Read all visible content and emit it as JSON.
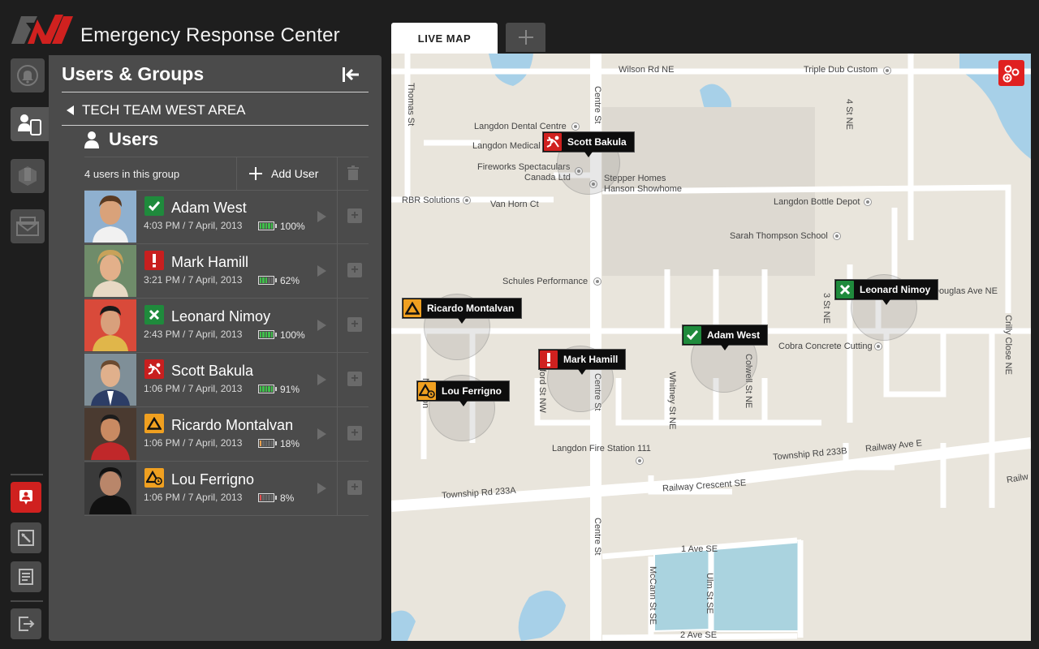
{
  "app": {
    "title": "Emergency Response Center",
    "accent": "#d0211f"
  },
  "rail": {
    "items": [
      {
        "icon": "bell-icon"
      },
      {
        "icon": "users-devices-icon",
        "active": true
      },
      {
        "icon": "buildings-icon"
      },
      {
        "icon": "mail-icon"
      },
      {
        "icon": "panic-alert-icon"
      },
      {
        "icon": "image-edit-icon"
      },
      {
        "icon": "notes-icon"
      },
      {
        "icon": "logout-icon"
      }
    ]
  },
  "panel": {
    "title": "Users & Groups",
    "breadcrumb": "TECH TEAM WEST AREA",
    "section_title": "Users",
    "count_text": "4 users in this group",
    "add_user_label": "Add User"
  },
  "users": [
    {
      "name": "Adam West",
      "time": "4:03 PM / 7 April, 2013",
      "battery": "100%",
      "battery_level": 1.0,
      "battery_color": "#3fbf4a",
      "status": "ok",
      "status_color": "#1f8a3c"
    },
    {
      "name": "Mark Hamill",
      "time": "3:21 PM / 7 April, 2013",
      "battery": "62%",
      "battery_level": 0.62,
      "battery_color": "#3fbf4a",
      "status": "alert",
      "status_color": "#c81f1f"
    },
    {
      "name": "Leonard Nimoy",
      "time": "2:43 PM / 7 April, 2013",
      "battery": "100%",
      "battery_level": 1.0,
      "battery_color": "#3fbf4a",
      "status": "cancelled",
      "status_color": "#1f8a3c"
    },
    {
      "name": "Scott Bakula",
      "time": "1:06 PM / 7 April, 2013",
      "battery": "91%",
      "battery_level": 0.91,
      "battery_color": "#3fbf4a",
      "status": "fallen",
      "status_color": "#c81f1f"
    },
    {
      "name": "Ricardo Montalvan",
      "time": "1:06 PM / 7 April, 2013",
      "battery": "18%",
      "battery_level": 0.18,
      "battery_color": "#e8a050",
      "status": "warning",
      "status_color": "#f0a020"
    },
    {
      "name": "Lou Ferrigno",
      "time": "1:06 PM / 7 April, 2013",
      "battery": "8%",
      "battery_level": 0.08,
      "battery_color": "#e05050",
      "status": "warning-timer",
      "status_color": "#f0a020"
    }
  ],
  "tabs": {
    "live_map": "LIVE MAP"
  },
  "map": {
    "labels": {
      "wilson": "Wilson Rd NE",
      "triple": "Triple Dub Custom",
      "thomas": "Thomas St",
      "centre_top": "Centre St",
      "ave4": "4 St NE",
      "dental": "Langdon Dental Centre",
      "medical": "Langdon Medical",
      "fireworks1": "Fireworks Spectaculars",
      "fireworks2": "Canada Ltd",
      "stepper1": "Stepper Homes",
      "stepper2": "Hanson Showhome",
      "rbr": "RBR Solutions",
      "vanhorn": "Van Horn Ct",
      "bottle": "Langdon Bottle Depot",
      "sarah": "Sarah Thompson School",
      "schules": "Schules Performance",
      "douglas": "Douglas Ave NE",
      "st3": "3 St NE",
      "crilly": "Crilly Close NE",
      "cobra": "Cobra Concrete Cutting",
      "colwell": "Colwell St NE",
      "whitney": "Whitney St NE",
      "centre_mid": "Centre St",
      "ssford": "ssford St NW",
      "newton": "Newton",
      "firestation": "Langdon Fire Station 111",
      "twp233b": "Township Rd 233B",
      "railway_ave": "Railway Ave E",
      "railway_cres": "Railway Crescent SE",
      "twp233a": "Township Rd 233A",
      "railw": "Railw",
      "centre_bot": "Centre St",
      "ave1": "1 Ave SE",
      "mccann": "McCann St SE",
      "ulm": "Ulm St SE",
      "ave2": "2 Ave SE"
    },
    "markers": {
      "scott": "Scott Bakula",
      "leonard": "Leonard Nimoy",
      "ricardo": "Ricardo Montalvan",
      "adam": "Adam West",
      "mark": "Mark Hamill",
      "lou": "Lou Ferrigno"
    }
  }
}
